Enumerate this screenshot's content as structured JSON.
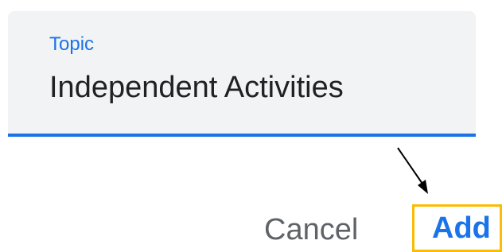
{
  "topic_field": {
    "label": "Topic",
    "value": "Independent Activities"
  },
  "dialog_actions": {
    "cancel_label": "Cancel",
    "add_label": "Add"
  },
  "colors": {
    "accent": "#1a73e8",
    "highlight_border": "#fbbc05",
    "field_background": "#f1f3f4",
    "cancel_text": "#5f6368"
  },
  "icons": {
    "pointer": "arrow-pointer-icon"
  }
}
